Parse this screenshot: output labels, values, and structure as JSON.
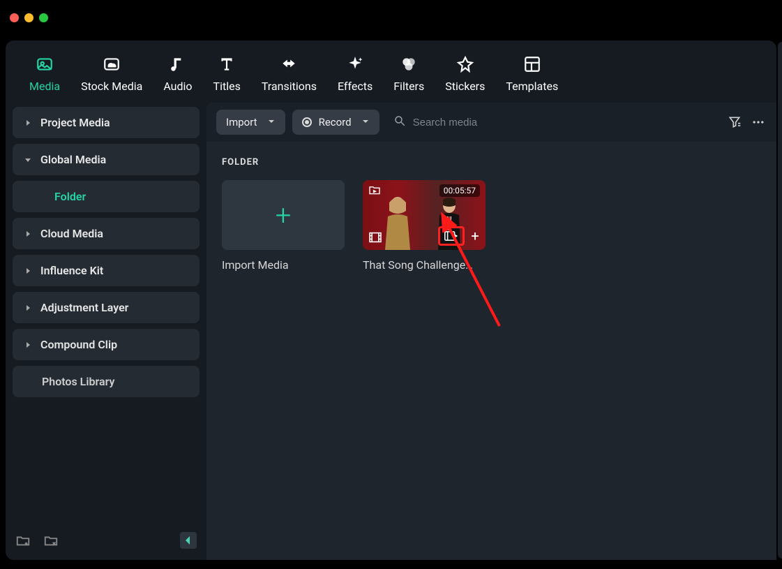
{
  "nav": {
    "media": "Media",
    "stock": "Stock Media",
    "audio": "Audio",
    "titles": "Titles",
    "transitions": "Transitions",
    "effects": "Effects",
    "filters": "Filters",
    "stickers": "Stickers",
    "templates": "Templates"
  },
  "sidebar": {
    "project_media": "Project Media",
    "global_media": "Global Media",
    "folder": "Folder",
    "cloud_media": "Cloud Media",
    "influence_kit": "Influence Kit",
    "adjustment_layer": "Adjustment Layer",
    "compound_clip": "Compound Clip",
    "photos_library": "Photos Library"
  },
  "toolbar": {
    "import": "Import",
    "record": "Record",
    "search_placeholder": "Search media"
  },
  "section": {
    "folder_title": "FOLDER"
  },
  "tiles": {
    "import_label": "Import Media",
    "clip1_label": "That Song Challenge…",
    "clip1_duration": "00:05:57"
  }
}
